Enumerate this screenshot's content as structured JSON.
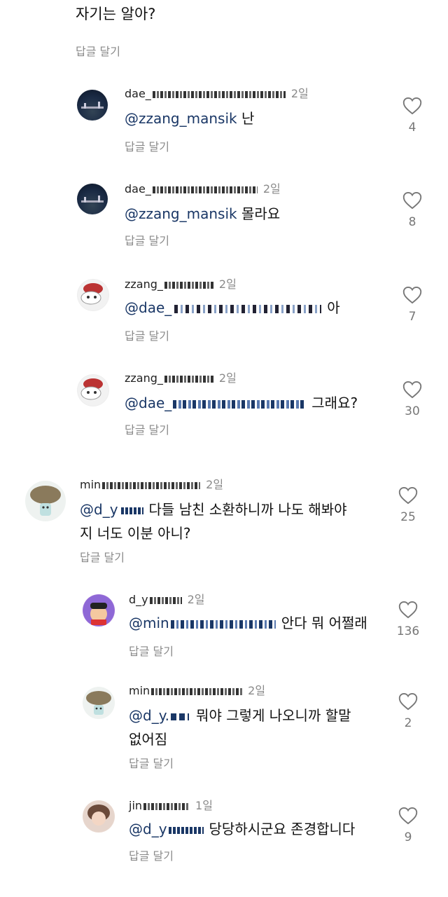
{
  "top_comment": {
    "text": "자기는 알아?",
    "reply": "답글 달기"
  },
  "comments": [
    {
      "user": "dae_",
      "time": "2일",
      "mention": "@zzang_mansik",
      "text": "난",
      "text2": "",
      "reply": "답글 달기",
      "likes": "4"
    },
    {
      "user": "dae_",
      "time": "2일",
      "mention": "@zzang_mansik",
      "text": "몰라요",
      "text2": "",
      "reply": "답글 달기",
      "likes": "8"
    },
    {
      "user": "zzang_",
      "time": "2일",
      "mention": "@dae_",
      "text": "아",
      "text2": "",
      "reply": "답글 달기",
      "likes": "7"
    },
    {
      "user": "zzang_",
      "time": "2일",
      "mention": "@dae_",
      "text": "그래요?",
      "text2": "",
      "reply": "답글 달기",
      "likes": "30"
    },
    {
      "user": "min",
      "time": "2일",
      "mention": "@d_y",
      "text": "다들 남친 소환하니까 나도 해봐야",
      "text2": "지 너도 이분 아니?",
      "reply": "답글 달기",
      "likes": "25"
    },
    {
      "user": "d_y",
      "time": "2일",
      "mention": "@min",
      "text": "안다 뭐 어쩔래",
      "text2": "",
      "reply": "답글 달기",
      "likes": "136"
    },
    {
      "user": "min",
      "time": "2일",
      "mention": "@d_y.",
      "text": "뭐야 그렇게 나오니까 할말",
      "text2": "없어짐",
      "reply": "답글 달기",
      "likes": "2"
    },
    {
      "user": "jin",
      "time": "1일",
      "mention": "@d_y",
      "text": "당당하시군요 존경합니다",
      "text2": "",
      "reply": "답글 달기",
      "likes": "9"
    }
  ]
}
